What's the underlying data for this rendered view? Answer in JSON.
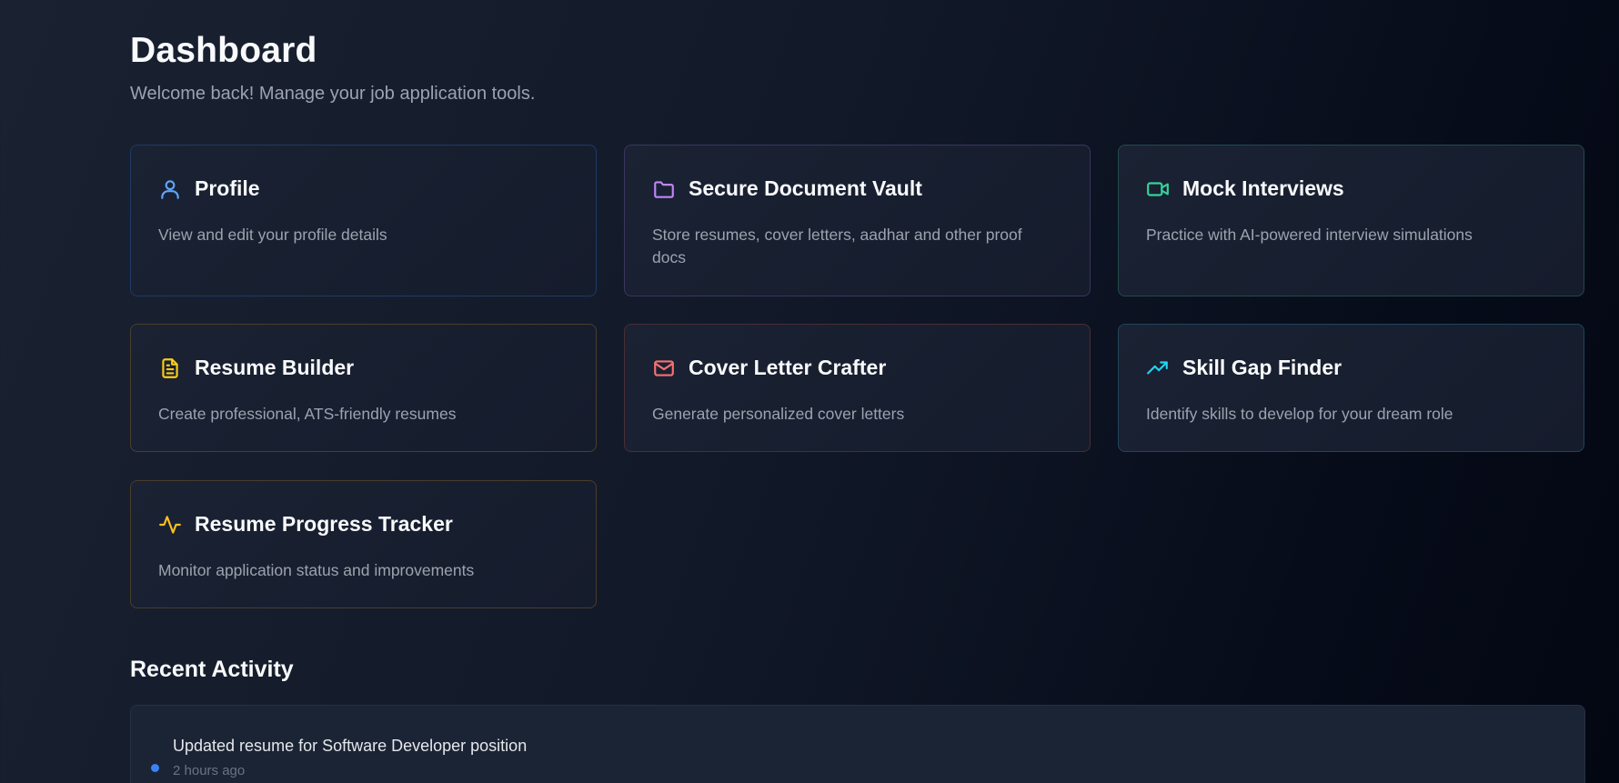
{
  "header": {
    "title": "Dashboard",
    "subtitle": "Welcome back! Manage your job application tools."
  },
  "cards": [
    {
      "title": "Profile",
      "description": "View and edit your profile details",
      "icon": "user-icon",
      "color": "#60a5fa",
      "border": "#1e3a66"
    },
    {
      "title": "Secure Document Vault",
      "description": "Store resumes, cover letters, aadhar and other proof docs",
      "icon": "folder-icon",
      "color": "#c084fc",
      "border": "#3b3560"
    },
    {
      "title": "Mock Interviews",
      "description": "Practice with AI-powered interview simulations",
      "icon": "video-icon",
      "color": "#34d399",
      "border": "#224a4a"
    },
    {
      "title": "Resume Builder",
      "description": "Create professional, ATS-friendly resumes",
      "icon": "file-text-icon",
      "color": "#facc15",
      "border": "#4a3f2a"
    },
    {
      "title": "Cover Letter Crafter",
      "description": "Generate personalized cover letters",
      "icon": "mail-icon",
      "color": "#f87171",
      "border": "#4a2d35"
    },
    {
      "title": "Skill Gap Finder",
      "description": "Identify skills to develop for your dream role",
      "icon": "trending-up-icon",
      "color": "#22d3ee",
      "border": "#22445a"
    },
    {
      "title": "Resume Progress Tracker",
      "description": "Monitor application status and improvements",
      "icon": "activity-icon",
      "color": "#fbbf24",
      "border": "#4a3c2a"
    }
  ],
  "recent_activity": {
    "title": "Recent Activity",
    "items": [
      {
        "text": "Updated resume for Software Developer position",
        "time": "2 hours ago",
        "dot_color": "#3b82f6"
      }
    ]
  }
}
